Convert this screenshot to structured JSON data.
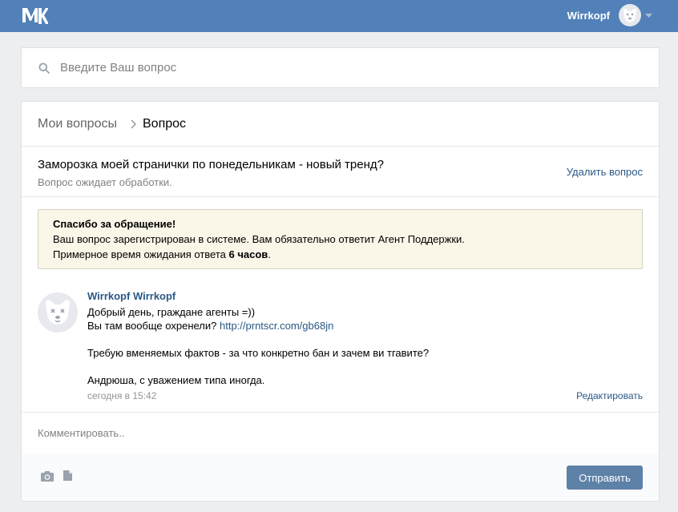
{
  "header": {
    "logo": "vk-logo-icon",
    "user_name": "Wirrkopf",
    "avatar": "dog-avatar-icon",
    "caret": "chevron-down-icon",
    "bar_color": "#5181b8"
  },
  "search": {
    "placeholder": "Введите Ваш вопрос",
    "value": "",
    "icon": "search-icon"
  },
  "breadcrumb": {
    "parent": "Мои вопросы",
    "separator": "chevron-right-icon",
    "current": "Вопрос"
  },
  "question": {
    "title": "Заморозка моей странички по понедельникам - новый тренд?",
    "status": "Вопрос ожидает обработки.",
    "delete_label": "Удалить вопрос"
  },
  "notice": {
    "title": "Спасибо за обращение!",
    "line1": "Ваш вопрос зарегистрирован в системе. Вам обязательно ответит Агент Поддержки.",
    "line2_prefix": "Примерное время ожидания ответа ",
    "line2_bold": "6 часов",
    "line2_suffix": ".",
    "background": "#faf6e8"
  },
  "post": {
    "author": "Wirrkopf Wirrkopf",
    "line1": "Добрый день, граждане агенты =))",
    "line2_prefix": "Вы там вообще охренели? ",
    "line2_link": "http://prntscr.com/gb68jn",
    "line3": "Требую вменяемых фактов - за что конкретно бан и зачем ви тгавите?",
    "line4": "Андрюша, с уважением типа иногда.",
    "time": "сегодня в 15:42",
    "edit_label": "Редактировать",
    "link_color": "#2a5885"
  },
  "comment": {
    "placeholder": "Комментировать..",
    "value": ""
  },
  "footer": {
    "camera_icon": "camera-icon",
    "doc_icon": "document-icon",
    "send_label": "Отправить",
    "button_color": "#5e81a8"
  }
}
